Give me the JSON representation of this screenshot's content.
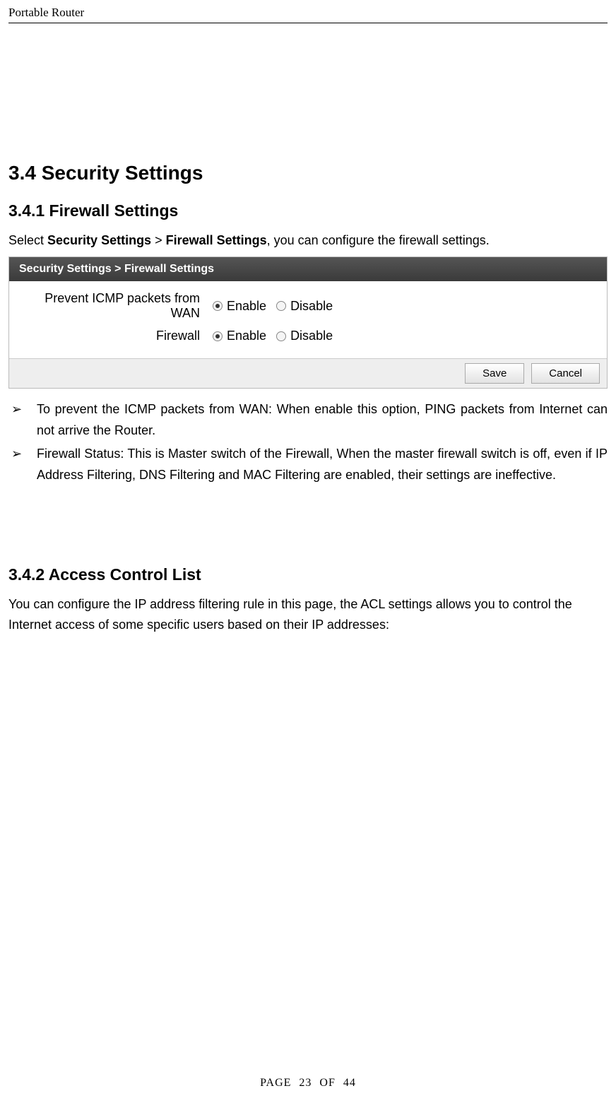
{
  "header": {
    "title": "Portable Router"
  },
  "section": {
    "heading_3_4": "3.4 Security Settings",
    "heading_3_4_1": "3.4.1 Firewall Settings",
    "intro_3_4_1_pre": "Select ",
    "intro_3_4_1_b1": "Security Settings",
    "intro_3_4_1_sep": " > ",
    "intro_3_4_1_b2": "Firewall Settings",
    "intro_3_4_1_post": ", you can configure the firewall settings.",
    "heading_3_4_2": "3.4.2 Access Control List",
    "intro_3_4_2": "You can configure the IP address filtering rule in this page, the ACL settings allows you to control the Internet access of some specific users based on their IP addresses:"
  },
  "panel": {
    "title": "Security Settings > Firewall Settings",
    "row1_label": "Prevent ICMP packets from WAN",
    "row2_label": "Firewall",
    "opt_enable": "Enable",
    "opt_disable": "Disable",
    "save": "Save",
    "cancel": "Cancel"
  },
  "bullets": {
    "item1": "To prevent the ICMP packets from WAN: When enable this option, PING packets from Internet can not arrive the Router.",
    "item2": "Firewall Status: This is Master switch of the Firewall, When the master firewall switch is off, even if IP Address Filtering, DNS Filtering and MAC Filtering are enabled, their settings are ineffective."
  },
  "footer": {
    "text": "PAGE  23  OF  44"
  }
}
